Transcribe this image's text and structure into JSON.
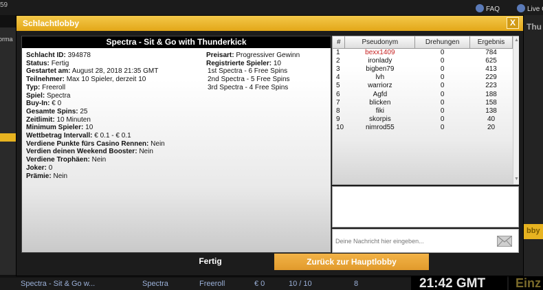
{
  "background": {
    "top_left_number": "59",
    "faq_label": "FAQ",
    "live_label": "Live C",
    "left_fragment": "orma",
    "right_fragment": "Thu",
    "right_button_fragment": "bby",
    "bottom_row": {
      "name": "Spectra - Sit & Go w...",
      "game": "Spectra",
      "type": "Freeroll",
      "buyin": "€ 0",
      "players": "10 / 10",
      "spins": "8"
    },
    "clock": "21:42  GMT",
    "clock_fragment": "Einz"
  },
  "dialog": {
    "title": "Schlachtlobby",
    "close_label": "X",
    "header": "Spectra - Sit & Go with Thunderkick",
    "info_left": [
      {
        "label": "Schlacht ID:",
        "value": "394878"
      },
      {
        "label": "Status:",
        "value": "Fertig"
      },
      {
        "label": "Gestartet am:",
        "value": "August 28, 2018 21:35 GMT"
      },
      {
        "label": "Teilnehmer:",
        "value": "Max 10 Spieler, derzeit 10"
      },
      {
        "label": "Typ:",
        "value": "Freeroll"
      },
      {
        "label": "Spiel:",
        "value": "Spectra"
      },
      {
        "label": "Buy-In:",
        "value": "€ 0"
      },
      {
        "label": "Gesamte Spins:",
        "value": "25"
      },
      {
        "label": "Zeitlimit:",
        "value": "10 Minuten"
      },
      {
        "label": "Minimum Spieler:",
        "value": "10"
      },
      {
        "label": "Wettbetrag Intervall:",
        "value": "€ 0.1 - € 0.1"
      },
      {
        "label": "Verdiene Punkte fürs Casino Rennen:",
        "value": "Nein"
      },
      {
        "label": "Verdien deinen Weekend Booster:",
        "value": "Nein"
      },
      {
        "label": "Verdiene Trophäen:",
        "value": "Nein"
      },
      {
        "label": "Joker:",
        "value": "0"
      },
      {
        "label": "Prämie:",
        "value": "Nein"
      }
    ],
    "info_right": [
      {
        "label": "Preisart:",
        "value": "Progressiver Gewinn"
      },
      {
        "label": "Registrierte Spieler:",
        "value": "10"
      }
    ],
    "prizes": [
      "1st  Spectra - 6 Free Spins",
      "2nd Spectra - 5 Free Spins",
      "3rd  Spectra - 4 Free Spins"
    ],
    "results": {
      "columns": [
        "#",
        "Pseudonym",
        "Drehungen",
        "Ergebnis"
      ],
      "rows": [
        {
          "rank": "1",
          "name": "bexx1409",
          "spins": "0",
          "score": "784"
        },
        {
          "rank": "2",
          "name": "ironlady",
          "spins": "0",
          "score": "625"
        },
        {
          "rank": "3",
          "name": "bigben79",
          "spins": "0",
          "score": "413"
        },
        {
          "rank": "4",
          "name": "lvh",
          "spins": "0",
          "score": "229"
        },
        {
          "rank": "5",
          "name": "warriorz",
          "spins": "0",
          "score": "223"
        },
        {
          "rank": "6",
          "name": "Agfd",
          "spins": "0",
          "score": "188"
        },
        {
          "rank": "7",
          "name": "blicken",
          "spins": "0",
          "score": "158"
        },
        {
          "rank": "8",
          "name": "fiki",
          "spins": "0",
          "score": "138"
        },
        {
          "rank": "9",
          "name": "skorpis",
          "spins": "0",
          "score": "40"
        },
        {
          "rank": "10",
          "name": "nimrod55",
          "spins": "0",
          "score": "20"
        }
      ]
    },
    "chat_placeholder": "Deine Nachricht hier eingeben...",
    "button_done": "Fertig",
    "button_back": "Zurück zur Hauptlobby",
    "colors": {
      "title_bar": "#e9b52a",
      "winner_name": "#c62020",
      "back_button": "#e8a53a"
    }
  }
}
